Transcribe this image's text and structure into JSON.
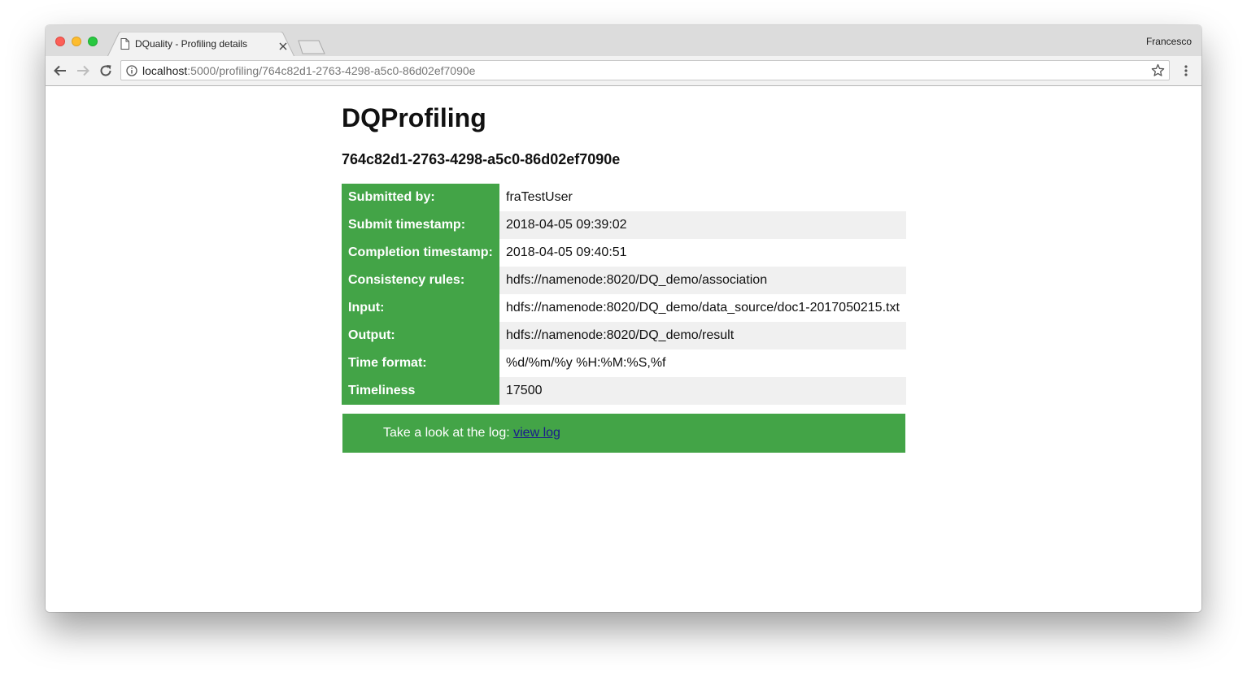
{
  "browser": {
    "tab_title": "DQuality - Profiling details",
    "profile_name": "Francesco",
    "url_host": "localhost",
    "url_path": ":5000/profiling/764c82d1-2763-4298-a5c0-86d02ef7090e"
  },
  "page": {
    "title": "DQProfiling",
    "job_id": "764c82d1-2763-4298-a5c0-86d02ef7090e",
    "details": [
      {
        "key": "Submitted by:",
        "value": "fraTestUser"
      },
      {
        "key": "Submit timestamp:",
        "value": "2018-04-05 09:39:02"
      },
      {
        "key": "Completion timestamp:",
        "value": "2018-04-05 09:40:51"
      },
      {
        "key": "Consistency rules:",
        "value": "hdfs://namenode:8020/DQ_demo/association"
      },
      {
        "key": "Input:",
        "value": "hdfs://namenode:8020/DQ_demo/data_source/doc1-2017050215.txt"
      },
      {
        "key": "Output:",
        "value": "hdfs://namenode:8020/DQ_demo/result"
      },
      {
        "key": "Time format:",
        "value": "%d/%m/%y %H:%M:%S,%f"
      },
      {
        "key": "Timeliness",
        "value": "17500"
      }
    ],
    "log_prompt": "Take a look at the log: ",
    "log_link": "view log"
  },
  "colors": {
    "accent_green": "#43a447",
    "row_alt": "#f0f0f0",
    "link": "#1a1a8c"
  },
  "icons": [
    "page-icon",
    "close-icon",
    "back-arrow-icon",
    "forward-arrow-icon",
    "reload-icon",
    "info-icon",
    "star-icon",
    "menu-dots-icon"
  ]
}
